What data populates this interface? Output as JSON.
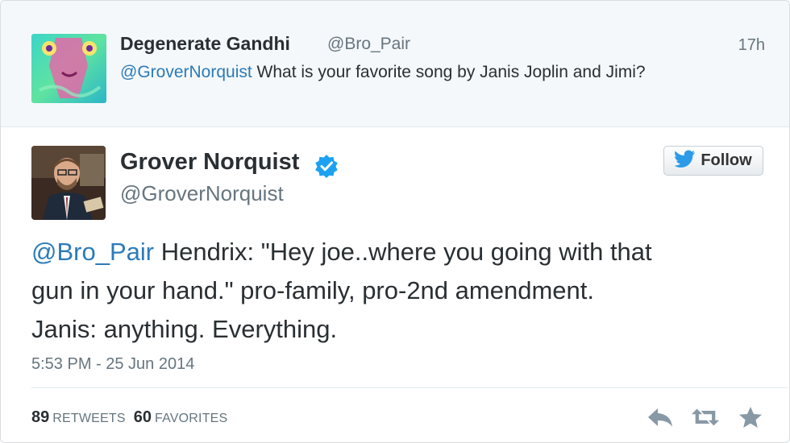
{
  "parent_tweet": {
    "name": "Degenerate Gandhi",
    "handle": "@Bro_Pair",
    "time": "17h",
    "mention": "@GroverNorquist",
    "text": "What is your favorite song by Janis Joplin and Jimi?"
  },
  "main_tweet": {
    "name": "Grover Norquist",
    "handle": "@GroverNorquist",
    "follow_label": "Follow",
    "mention": "@Bro_Pair",
    "text_line1_rest": "Hendrix: \"Hey joe..where you going with that",
    "text_line2": "gun in your hand.\" pro-family, pro-2nd amendment.",
    "text_line3": "Janis: anything. Everything.",
    "timestamp": "5:53 PM - 25 Jun 2014",
    "retweets_count": "89",
    "retweets_label": "RETWEETS",
    "favorites_count": "60",
    "favorites_label": "FAVORITES"
  },
  "icons": {
    "verified": "verified-badge-icon",
    "follow_bird": "twitter-bird-icon",
    "reply": "reply-icon",
    "retweet": "retweet-icon",
    "favorite": "star-icon"
  },
  "colors": {
    "link": "#2b7bb9",
    "verified": "#1da1f2",
    "muted_text": "#66757f",
    "parent_bg": "#f5f8fa"
  }
}
